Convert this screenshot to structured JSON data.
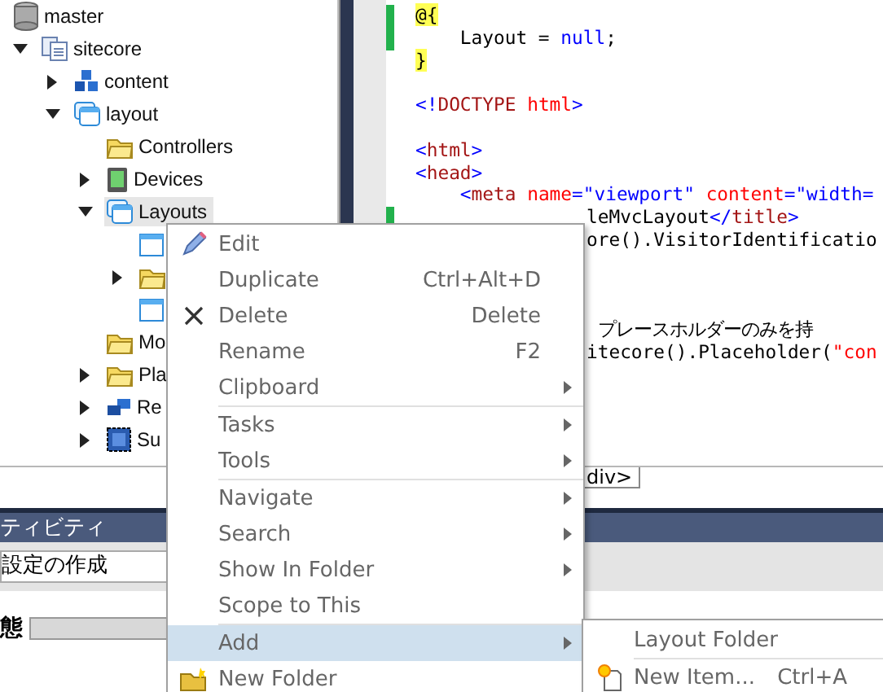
{
  "tree": [
    {
      "label": "master",
      "kind": "database",
      "selected": false,
      "children": [
        {
          "label": "sitecore",
          "kind": "document",
          "expanded": true,
          "selected": false,
          "children": [
            {
              "label": "content",
              "kind": "cubes",
              "expanded": false,
              "selected": false
            },
            {
              "label": "layout",
              "kind": "window",
              "expanded": true,
              "selected": false,
              "children": [
                {
                  "label": "Controllers",
                  "kind": "folder",
                  "selected": false
                },
                {
                  "label": "Devices",
                  "kind": "device",
                  "expanded": false,
                  "selected": false
                },
                {
                  "label": "Layouts",
                  "kind": "window",
                  "expanded": true,
                  "selected": true,
                  "children": [
                    {
                      "kind": "page",
                      "selected": false
                    },
                    {
                      "kind": "folder",
                      "expanded": false,
                      "selected": false
                    },
                    {
                      "kind": "page",
                      "selected": false
                    }
                  ]
                },
                {
                  "label": "Mo",
                  "kind": "folder",
                  "selected": false
                },
                {
                  "label": "Pla",
                  "kind": "folder",
                  "expanded": false,
                  "selected": false
                },
                {
                  "label": "Re",
                  "kind": "blocks",
                  "expanded": false,
                  "selected": false
                },
                {
                  "label": "Su",
                  "kind": "dashed",
                  "expanded": false,
                  "selected": false
                }
              ]
            }
          ]
        }
      ]
    }
  ],
  "code": [
    {
      "kind": "full",
      "changed": true,
      "segments": [
        {
          "text": "@{",
          "kind": "razor"
        }
      ]
    },
    {
      "kind": "full",
      "changed": true,
      "segments": [
        {
          "text": "    Layout = ",
          "kind": "text"
        },
        {
          "text": "null",
          "kind": "keyword"
        },
        {
          "text": ";",
          "kind": "text"
        }
      ]
    },
    {
      "kind": "full",
      "changed": false,
      "segments": [
        {
          "text": "}",
          "kind": "razor"
        }
      ]
    },
    {
      "kind": "blank",
      "changed": false
    },
    {
      "kind": "full",
      "changed": false,
      "segments": [
        {
          "text": "<!",
          "kind": "keyword"
        },
        {
          "text": "DOCTYPE",
          "kind": "tag"
        },
        {
          "text": " html",
          "kind": "attr"
        },
        {
          "text": ">",
          "kind": "keyword"
        }
      ]
    },
    {
      "kind": "blank",
      "changed": false
    },
    {
      "kind": "full",
      "changed": false,
      "segments": [
        {
          "text": "<",
          "kind": "keyword"
        },
        {
          "text": "html",
          "kind": "tag"
        },
        {
          "text": ">",
          "kind": "keyword"
        }
      ]
    },
    {
      "kind": "full",
      "changed": false,
      "segments": [
        {
          "text": "<",
          "kind": "keyword"
        },
        {
          "text": "head",
          "kind": "tag"
        },
        {
          "text": ">",
          "kind": "keyword"
        }
      ]
    },
    {
      "kind": "full",
      "changed": false,
      "segments": [
        {
          "text": "    <",
          "kind": "keyword"
        },
        {
          "text": "meta",
          "kind": "tag"
        },
        {
          "text": " name",
          "kind": "attr"
        },
        {
          "text": "=\"viewport\"",
          "kind": "keyword"
        },
        {
          "text": " content",
          "kind": "attr"
        },
        {
          "text": "=\"width=",
          "kind": "keyword"
        }
      ]
    },
    {
      "kind": "covered",
      "changed": true,
      "segments": [
        {
          "text": "leMvcLayout",
          "kind": "text"
        },
        {
          "text": "</",
          "kind": "keyword"
        },
        {
          "text": "title",
          "kind": "tag"
        },
        {
          "text": ">",
          "kind": "keyword"
        }
      ]
    },
    {
      "kind": "covered",
      "segments": [
        {
          "text": "ore().VisitorIdentificatio",
          "kind": "text"
        }
      ]
    },
    {
      "kind": "blank"
    },
    {
      "kind": "blank"
    },
    {
      "kind": "blank"
    },
    {
      "kind": "covered",
      "segments": [
        {
          "text": " プレースホルダーのみを持",
          "kind": "comment"
        }
      ]
    },
    {
      "kind": "covered",
      "segments": [
        {
          "text": "itecore().Placeholder(",
          "kind": "text"
        },
        {
          "text": "\"con",
          "kind": "attr"
        }
      ]
    }
  ],
  "editor_tab": "div>",
  "panel": {
    "title": "ティビティ",
    "field": "設定の作成",
    "status_label": "態",
    "level": 0
  },
  "menu": [
    {
      "kind": "pencil-item",
      "label": "Edit",
      "submenu": false,
      "highlighted": false
    },
    {
      "kind": "item",
      "label": "Duplicate",
      "shortcut": "Ctrl+Alt+D",
      "submenu": false,
      "highlighted": false
    },
    {
      "kind": "cross-item",
      "label": "Delete",
      "shortcut": "Delete",
      "submenu": false,
      "highlighted": false
    },
    {
      "kind": "item",
      "label": "Rename",
      "shortcut": "F2",
      "submenu": false,
      "highlighted": false
    },
    {
      "kind": "item",
      "label": "Clipboard",
      "submenu": true,
      "highlighted": false
    },
    {
      "kind": "separator"
    },
    {
      "kind": "item",
      "label": "Tasks",
      "submenu": true,
      "highlighted": false
    },
    {
      "kind": "item",
      "label": "Tools",
      "submenu": true,
      "highlighted": false
    },
    {
      "kind": "separator"
    },
    {
      "kind": "item",
      "label": "Navigate",
      "submenu": true,
      "highlighted": false
    },
    {
      "kind": "item",
      "label": "Search",
      "submenu": true,
      "highlighted": false
    },
    {
      "kind": "item",
      "label": "Show In Folder",
      "submenu": true,
      "highlighted": false
    },
    {
      "kind": "item",
      "label": "Scope to This",
      "submenu": false,
      "highlighted": false
    },
    {
      "kind": "separator"
    },
    {
      "kind": "item",
      "label": "Add",
      "submenu": true,
      "highlighted": true
    },
    {
      "kind": "folder-item",
      "label": "New Folder",
      "submenu": false,
      "highlighted": false
    }
  ],
  "submenu": [
    {
      "kind": "item",
      "label": "Layout Folder",
      "submenu": false,
      "highlighted": false
    },
    {
      "kind": "separator"
    },
    {
      "kind": "new-item",
      "label": "New Item...",
      "shortcut": "Ctrl+A",
      "submenu": false,
      "highlighted": false
    }
  ]
}
